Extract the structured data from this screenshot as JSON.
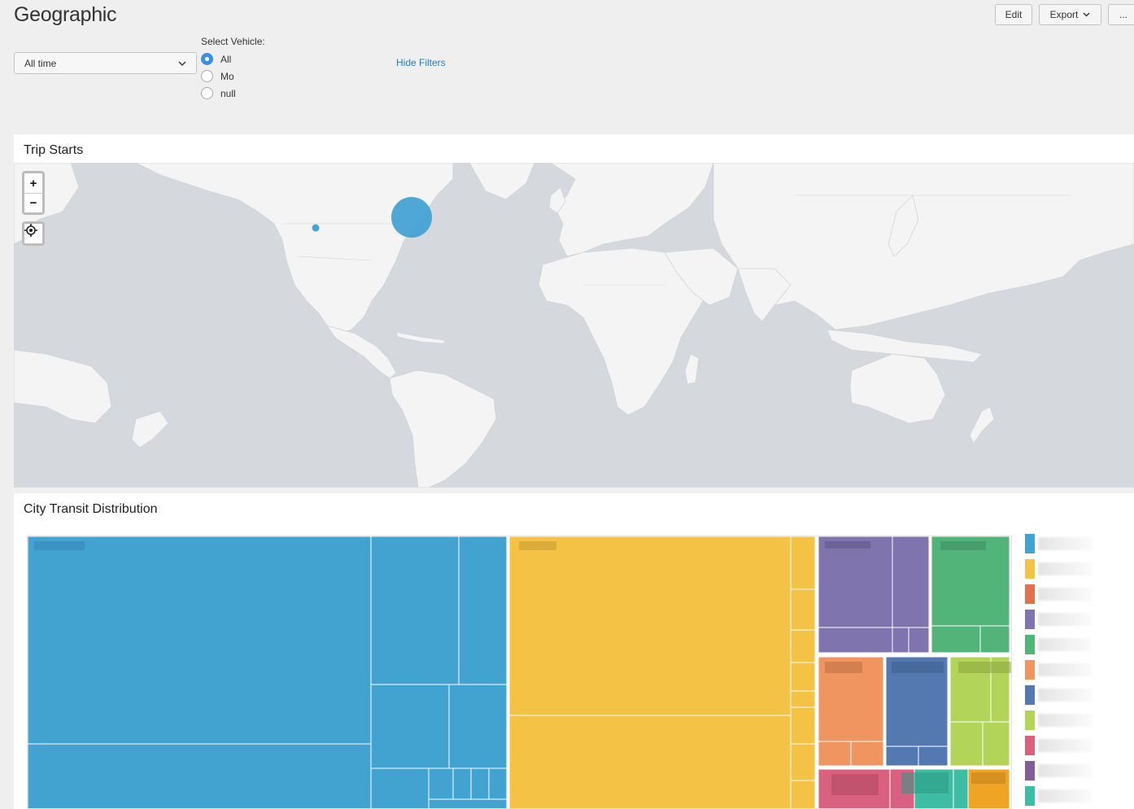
{
  "page": {
    "title": "Geographic"
  },
  "toolbar": {
    "edit_label": "Edit",
    "export_label": "Export",
    "more_label": "..."
  },
  "filters": {
    "time_value": "All time",
    "vehicle_label": "Select Vehicle:",
    "vehicle_options": [
      {
        "label": "All",
        "checked": true
      },
      {
        "label": "Mo",
        "checked": false
      },
      {
        "label": "null",
        "checked": false
      }
    ],
    "hide_filters_label": "Hide Filters"
  },
  "panels": {
    "trip_starts": {
      "title": "Trip Starts"
    },
    "city_transit": {
      "title": "City Transit Distribution"
    }
  },
  "map": {
    "controls": {
      "zoom_in": "+",
      "zoom_out": "−"
    },
    "bubble_color": "#45a2d3",
    "land_color": "#f4f4f4",
    "water_color": "#d5d9de"
  },
  "treemap": {
    "palette": [
      "#42a3d0",
      "#f4c245",
      "#e27152",
      "#8074ae",
      "#53b47a",
      "#f09560",
      "#5479b1",
      "#b2d458",
      "#d9607e",
      "#825e98",
      "#3dbda4"
    ]
  },
  "icons": {
    "dropdown": "chevron-down-icon",
    "locate": "crosshair-icon",
    "zoom_in": "plus-icon",
    "zoom_out": "minus-icon"
  }
}
